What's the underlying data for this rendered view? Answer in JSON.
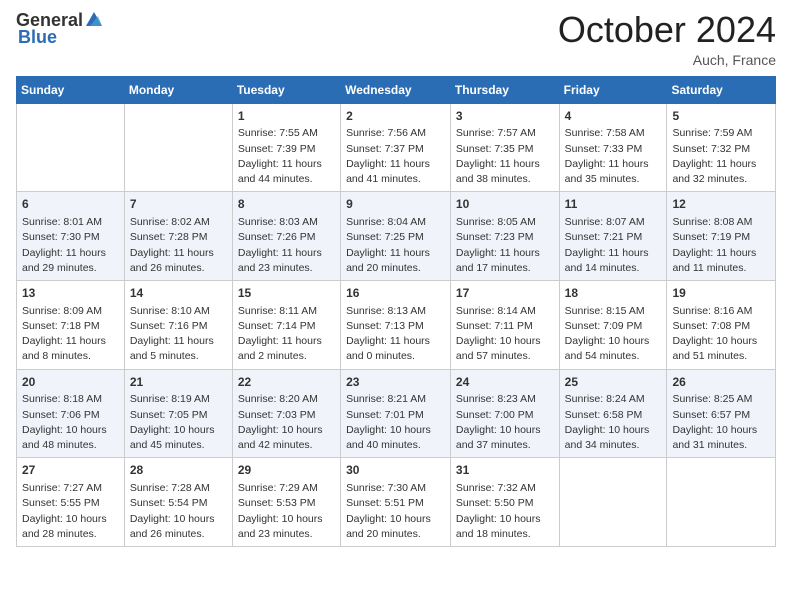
{
  "header": {
    "logo_general": "General",
    "logo_blue": "Blue",
    "month_title": "October 2024",
    "location": "Auch, France"
  },
  "weekdays": [
    "Sunday",
    "Monday",
    "Tuesday",
    "Wednesday",
    "Thursday",
    "Friday",
    "Saturday"
  ],
  "weeks": [
    [
      {
        "day": "",
        "sunrise": "",
        "sunset": "",
        "daylight": ""
      },
      {
        "day": "",
        "sunrise": "",
        "sunset": "",
        "daylight": ""
      },
      {
        "day": "1",
        "sunrise": "Sunrise: 7:55 AM",
        "sunset": "Sunset: 7:39 PM",
        "daylight": "Daylight: 11 hours and 44 minutes."
      },
      {
        "day": "2",
        "sunrise": "Sunrise: 7:56 AM",
        "sunset": "Sunset: 7:37 PM",
        "daylight": "Daylight: 11 hours and 41 minutes."
      },
      {
        "day": "3",
        "sunrise": "Sunrise: 7:57 AM",
        "sunset": "Sunset: 7:35 PM",
        "daylight": "Daylight: 11 hours and 38 minutes."
      },
      {
        "day": "4",
        "sunrise": "Sunrise: 7:58 AM",
        "sunset": "Sunset: 7:33 PM",
        "daylight": "Daylight: 11 hours and 35 minutes."
      },
      {
        "day": "5",
        "sunrise": "Sunrise: 7:59 AM",
        "sunset": "Sunset: 7:32 PM",
        "daylight": "Daylight: 11 hours and 32 minutes."
      }
    ],
    [
      {
        "day": "6",
        "sunrise": "Sunrise: 8:01 AM",
        "sunset": "Sunset: 7:30 PM",
        "daylight": "Daylight: 11 hours and 29 minutes."
      },
      {
        "day": "7",
        "sunrise": "Sunrise: 8:02 AM",
        "sunset": "Sunset: 7:28 PM",
        "daylight": "Daylight: 11 hours and 26 minutes."
      },
      {
        "day": "8",
        "sunrise": "Sunrise: 8:03 AM",
        "sunset": "Sunset: 7:26 PM",
        "daylight": "Daylight: 11 hours and 23 minutes."
      },
      {
        "day": "9",
        "sunrise": "Sunrise: 8:04 AM",
        "sunset": "Sunset: 7:25 PM",
        "daylight": "Daylight: 11 hours and 20 minutes."
      },
      {
        "day": "10",
        "sunrise": "Sunrise: 8:05 AM",
        "sunset": "Sunset: 7:23 PM",
        "daylight": "Daylight: 11 hours and 17 minutes."
      },
      {
        "day": "11",
        "sunrise": "Sunrise: 8:07 AM",
        "sunset": "Sunset: 7:21 PM",
        "daylight": "Daylight: 11 hours and 14 minutes."
      },
      {
        "day": "12",
        "sunrise": "Sunrise: 8:08 AM",
        "sunset": "Sunset: 7:19 PM",
        "daylight": "Daylight: 11 hours and 11 minutes."
      }
    ],
    [
      {
        "day": "13",
        "sunrise": "Sunrise: 8:09 AM",
        "sunset": "Sunset: 7:18 PM",
        "daylight": "Daylight: 11 hours and 8 minutes."
      },
      {
        "day": "14",
        "sunrise": "Sunrise: 8:10 AM",
        "sunset": "Sunset: 7:16 PM",
        "daylight": "Daylight: 11 hours and 5 minutes."
      },
      {
        "day": "15",
        "sunrise": "Sunrise: 8:11 AM",
        "sunset": "Sunset: 7:14 PM",
        "daylight": "Daylight: 11 hours and 2 minutes."
      },
      {
        "day": "16",
        "sunrise": "Sunrise: 8:13 AM",
        "sunset": "Sunset: 7:13 PM",
        "daylight": "Daylight: 11 hours and 0 minutes."
      },
      {
        "day": "17",
        "sunrise": "Sunrise: 8:14 AM",
        "sunset": "Sunset: 7:11 PM",
        "daylight": "Daylight: 10 hours and 57 minutes."
      },
      {
        "day": "18",
        "sunrise": "Sunrise: 8:15 AM",
        "sunset": "Sunset: 7:09 PM",
        "daylight": "Daylight: 10 hours and 54 minutes."
      },
      {
        "day": "19",
        "sunrise": "Sunrise: 8:16 AM",
        "sunset": "Sunset: 7:08 PM",
        "daylight": "Daylight: 10 hours and 51 minutes."
      }
    ],
    [
      {
        "day": "20",
        "sunrise": "Sunrise: 8:18 AM",
        "sunset": "Sunset: 7:06 PM",
        "daylight": "Daylight: 10 hours and 48 minutes."
      },
      {
        "day": "21",
        "sunrise": "Sunrise: 8:19 AM",
        "sunset": "Sunset: 7:05 PM",
        "daylight": "Daylight: 10 hours and 45 minutes."
      },
      {
        "day": "22",
        "sunrise": "Sunrise: 8:20 AM",
        "sunset": "Sunset: 7:03 PM",
        "daylight": "Daylight: 10 hours and 42 minutes."
      },
      {
        "day": "23",
        "sunrise": "Sunrise: 8:21 AM",
        "sunset": "Sunset: 7:01 PM",
        "daylight": "Daylight: 10 hours and 40 minutes."
      },
      {
        "day": "24",
        "sunrise": "Sunrise: 8:23 AM",
        "sunset": "Sunset: 7:00 PM",
        "daylight": "Daylight: 10 hours and 37 minutes."
      },
      {
        "day": "25",
        "sunrise": "Sunrise: 8:24 AM",
        "sunset": "Sunset: 6:58 PM",
        "daylight": "Daylight: 10 hours and 34 minutes."
      },
      {
        "day": "26",
        "sunrise": "Sunrise: 8:25 AM",
        "sunset": "Sunset: 6:57 PM",
        "daylight": "Daylight: 10 hours and 31 minutes."
      }
    ],
    [
      {
        "day": "27",
        "sunrise": "Sunrise: 7:27 AM",
        "sunset": "Sunset: 5:55 PM",
        "daylight": "Daylight: 10 hours and 28 minutes."
      },
      {
        "day": "28",
        "sunrise": "Sunrise: 7:28 AM",
        "sunset": "Sunset: 5:54 PM",
        "daylight": "Daylight: 10 hours and 26 minutes."
      },
      {
        "day": "29",
        "sunrise": "Sunrise: 7:29 AM",
        "sunset": "Sunset: 5:53 PM",
        "daylight": "Daylight: 10 hours and 23 minutes."
      },
      {
        "day": "30",
        "sunrise": "Sunrise: 7:30 AM",
        "sunset": "Sunset: 5:51 PM",
        "daylight": "Daylight: 10 hours and 20 minutes."
      },
      {
        "day": "31",
        "sunrise": "Sunrise: 7:32 AM",
        "sunset": "Sunset: 5:50 PM",
        "daylight": "Daylight: 10 hours and 18 minutes."
      },
      {
        "day": "",
        "sunrise": "",
        "sunset": "",
        "daylight": ""
      },
      {
        "day": "",
        "sunrise": "",
        "sunset": "",
        "daylight": ""
      }
    ]
  ]
}
